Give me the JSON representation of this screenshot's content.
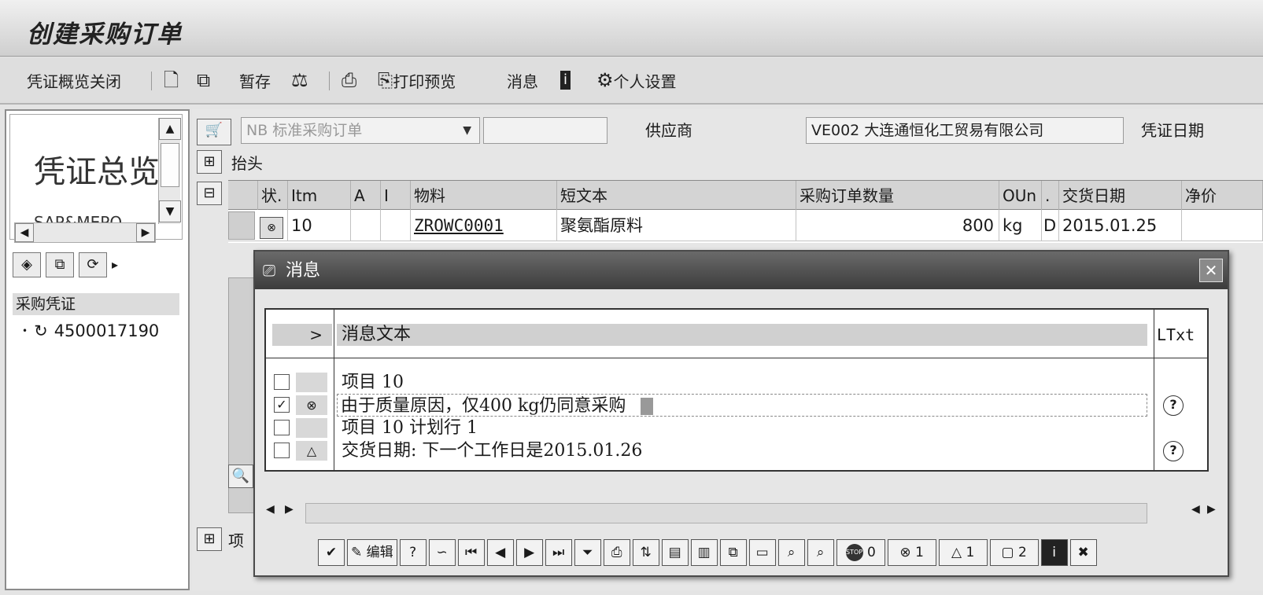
{
  "window": {
    "title": "创建采购订单"
  },
  "toolbar": {
    "doc_overview_close": "凭证概览关闭",
    "hold": "暂存",
    "print_preview": "打印预览",
    "messages": "消息",
    "personal_settings": "个人设置"
  },
  "left_pane": {
    "overview_title": "凭证总览",
    "overview_sub": "SAP&MEPO",
    "tree_header": "采购凭证",
    "tree_item": "4500017190"
  },
  "header": {
    "doc_type": "NB 标准采购订单",
    "vendor_label": "供应商",
    "vendor_value": "VE002 大连通恒化工贸易有限公司",
    "doc_date_label": "凭证日期",
    "header_label": "抬头",
    "item_label": "项"
  },
  "item_grid": {
    "columns": [
      "状.",
      "Itm",
      "A",
      "I",
      "物料",
      "短文本",
      "采购订单数量",
      "OUn",
      ".",
      "交货日期",
      "净价"
    ],
    "row": {
      "itm": "10",
      "material": "ZROWC0001",
      "short_text": "聚氨酯原料",
      "qty": "800",
      "oun": "kg",
      "d": "D",
      "delivery_date": "2015.01.25"
    }
  },
  "dialog": {
    "title": "消息",
    "col_expand": ">",
    "col_text": "消息文本",
    "col_ltxt": "LTxt",
    "messages": [
      {
        "text": "项目 10",
        "checked": false,
        "status": "",
        "ltxt": false
      },
      {
        "text": "由于质量原因，仅400 kg仍同意采购",
        "checked": true,
        "status": "error",
        "ltxt": true
      },
      {
        "text": "项目 10 计划行 1",
        "checked": false,
        "status": "",
        "ltxt": false
      },
      {
        "text": "交货日期: 下一个工作日是2015.01.26",
        "checked": false,
        "status": "warning",
        "ltxt": true
      }
    ],
    "buttons": {
      "edit": "编辑",
      "stop_count": "0",
      "error_count": "1",
      "warning_count": "1",
      "info_count": "2"
    }
  }
}
